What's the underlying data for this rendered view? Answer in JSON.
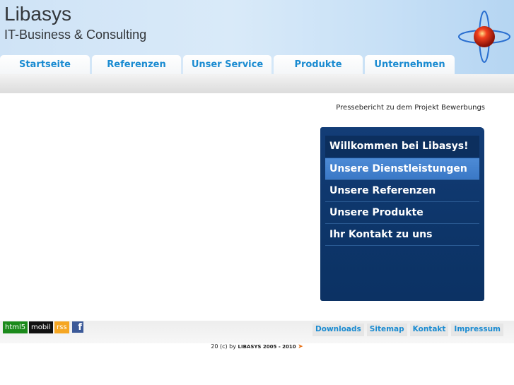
{
  "header": {
    "title": "Libasys",
    "subtitle": "IT-Business & Consulting",
    "logo_icon": "orbit-sphere-icon"
  },
  "nav": {
    "tabs": [
      {
        "label": "Startseite"
      },
      {
        "label": "Referenzen"
      },
      {
        "label": "Unser Service"
      },
      {
        "label": "Produkte"
      },
      {
        "label": "Unternehmen"
      }
    ]
  },
  "main": {
    "press_text": "Pressebericht zu dem Projekt Bewerbungs"
  },
  "sidebar": {
    "welcome": "Willkommen bei Libasys!",
    "items": [
      {
        "label": "Unsere Dienstleistungen",
        "active": true
      },
      {
        "label": "Unsere Referenzen"
      },
      {
        "label": "Unsere Produkte"
      },
      {
        "label": "Ihr Kontakt zu uns"
      }
    ]
  },
  "footer": {
    "badges": {
      "html5": "html5",
      "mobil": "mobil",
      "rss": "rss",
      "facebook": "f"
    },
    "links": [
      {
        "label": "Downloads"
      },
      {
        "label": "Sitemap"
      },
      {
        "label": "Kontakt"
      },
      {
        "label": "Impressum"
      }
    ],
    "copyright_prefix": "20 (c) by",
    "copyright_brand": "LIBASYS 2005 - 2010"
  },
  "colors": {
    "accent": "#1a8bd1",
    "sidebar_bg": "#0d3569",
    "active_item": "#3a78c6"
  }
}
